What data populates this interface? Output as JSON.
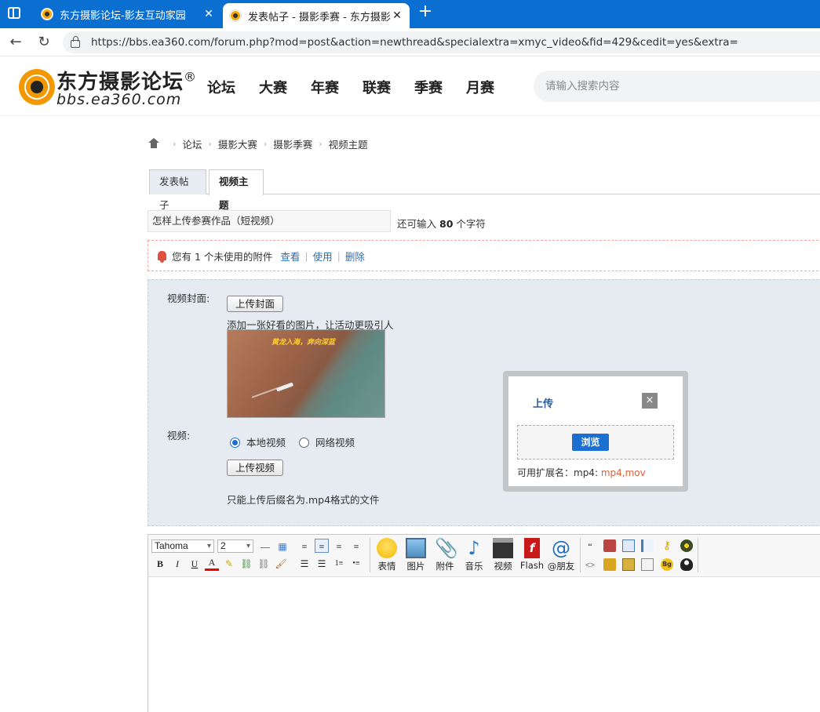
{
  "browser": {
    "tabs": [
      {
        "title": "东方摄影论坛-影友互动家园",
        "active": false
      },
      {
        "title": "发表帖子 - 摄影季赛 - 东方摄影论",
        "active": true
      }
    ],
    "url": "https://bbs.ea360.com/forum.php?mod=post&action=newthread&specialextra=xmyc_video&fid=429&cedit=yes&extra="
  },
  "site": {
    "logo_name": "东方摄影论坛",
    "logo_reg": "®",
    "logo_url": "bbs.ea360.com",
    "nav": [
      "论坛",
      "大赛",
      "年赛",
      "联赛",
      "季赛",
      "月赛"
    ],
    "search_placeholder": "请输入搜索内容"
  },
  "breadcrumb": [
    "论坛",
    "摄影大赛",
    "摄影季赛",
    "视频主题"
  ],
  "post_tabs": [
    "发表帖子",
    "视频主题"
  ],
  "subject": {
    "value": "怎样上传参赛作品（短视频）",
    "hint_prefix": "还可输入",
    "hint_count": "80",
    "hint_suffix": "个字符"
  },
  "notice": {
    "text": "您有 1 个未使用的附件",
    "links": [
      "查看",
      "使用",
      "删除"
    ]
  },
  "video_form": {
    "cover_label": "视频封面:",
    "cover_button": "上传封面",
    "cover_hint": "添加一张好看的图片，让活动更吸引人",
    "cover_caption": "黄龙入海，奔向深蓝",
    "video_label": "视频:",
    "radio_local": "本地视频",
    "radio_network": "网络视频",
    "radio_selected": "本地视频",
    "video_button": "上传视频",
    "video_hint": "只能上传后缀名为.mp4格式的文件"
  },
  "upload_dialog": {
    "title": "上传",
    "close": "×",
    "browse": "浏览",
    "ext_label": "可用扩展名：mp4:",
    "ext_values": "mp4,mov"
  },
  "editor": {
    "font_family": "Tahoma",
    "font_size": "2",
    "format_buttons": [
      "B",
      "I",
      "U"
    ],
    "tools": [
      "表情",
      "图片",
      "附件",
      "音乐",
      "视频",
      "Flash",
      "@朋友"
    ]
  },
  "colors": {
    "tabbar": "#0b6fd1",
    "link": "#2a6db5",
    "accent_red": "#e0603a",
    "browse_button": "#1b6fd0",
    "panel_bg": "#e5ebf1"
  }
}
